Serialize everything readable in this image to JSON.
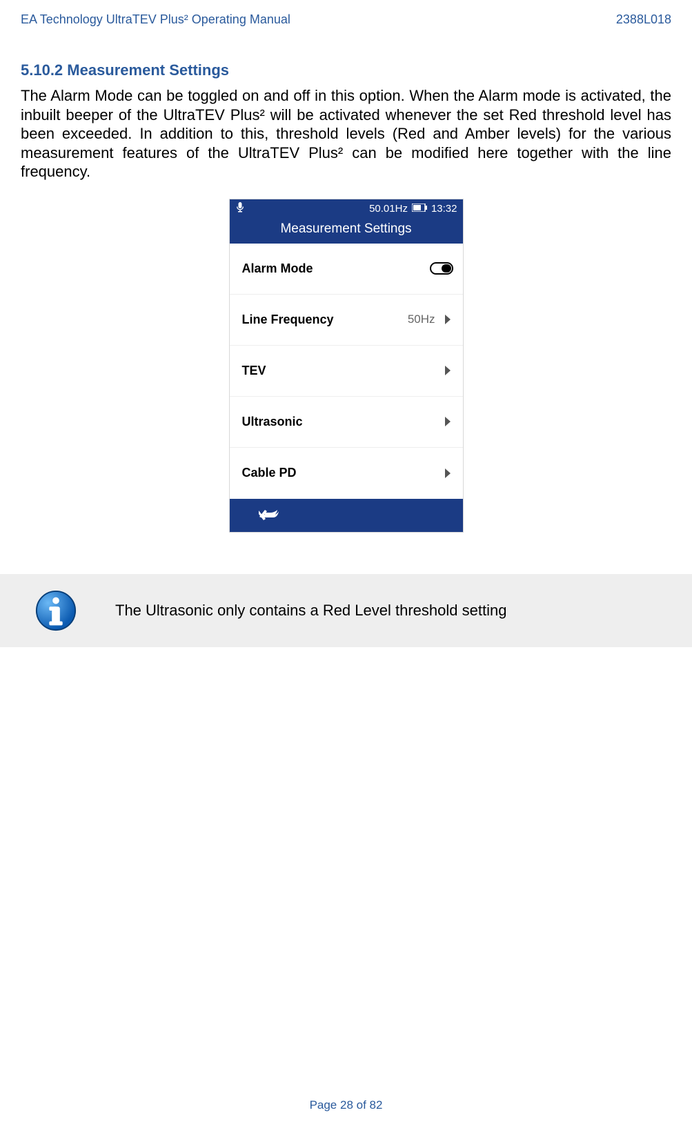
{
  "header": {
    "left": "EA Technology UltraTEV Plus² Operating Manual",
    "right": "2388L018"
  },
  "section_heading": "5.10.2 Measurement Settings",
  "body_text": "The Alarm Mode can be toggled on and off in this option. When the Alarm mode is activated, the inbuilt beeper of the UltraTEV Plus² will be activated whenever the set Red threshold level has been exceeded. In addition to this, threshold levels (Red and Amber levels) for the various measurement features of the UltraTEV Plus² can be modified here together with the line frequency.",
  "device": {
    "status": {
      "frequency": "50.01Hz",
      "time": "13:32"
    },
    "title": "Measurement Settings",
    "rows": {
      "alarm_mode": "Alarm Mode",
      "line_frequency": "Line Frequency",
      "line_frequency_value": "50Hz",
      "tev": "TEV",
      "ultrasonic": "Ultrasonic",
      "cable_pd": "Cable PD"
    }
  },
  "info_text": "The Ultrasonic only contains a Red Level threshold setting",
  "footer": "Page 28 of 82"
}
